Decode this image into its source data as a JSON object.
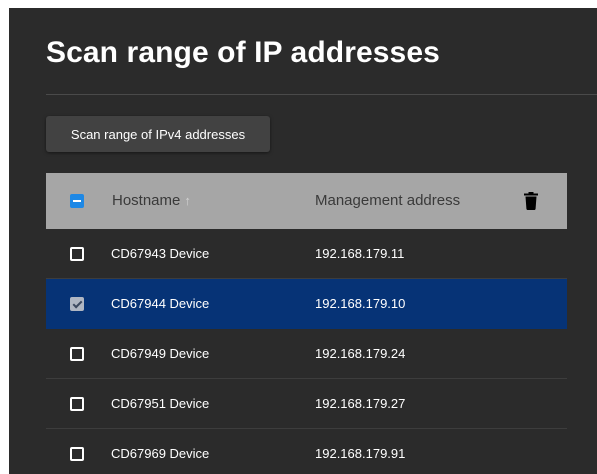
{
  "page": {
    "title": "Scan range of IP addresses",
    "scan_button_label": "Scan range of IPv4 addresses"
  },
  "table": {
    "columns": {
      "hostname": "Hostname",
      "sort_indicator": "↑",
      "management_address": "Management address"
    },
    "header_checkbox_state": "indeterminate",
    "rows": [
      {
        "hostname": "CD67943 Device",
        "address": "192.168.179.11",
        "selected": false
      },
      {
        "hostname": "CD67944 Device",
        "address": "192.168.179.10",
        "selected": true
      },
      {
        "hostname": "CD67949 Device",
        "address": "192.168.179.24",
        "selected": false
      },
      {
        "hostname": "CD67951 Device",
        "address": "192.168.179.27",
        "selected": false
      },
      {
        "hostname": "CD67969 Device",
        "address": "192.168.179.91",
        "selected": false
      }
    ]
  },
  "icons": {
    "delete": "trash-icon",
    "sort": "arrow-up-icon"
  },
  "colors": {
    "background": "#2b2b2b",
    "header_bg": "#a6a6a6",
    "selected_row": "#063376",
    "checkbox_accent": "#1e88e5"
  }
}
